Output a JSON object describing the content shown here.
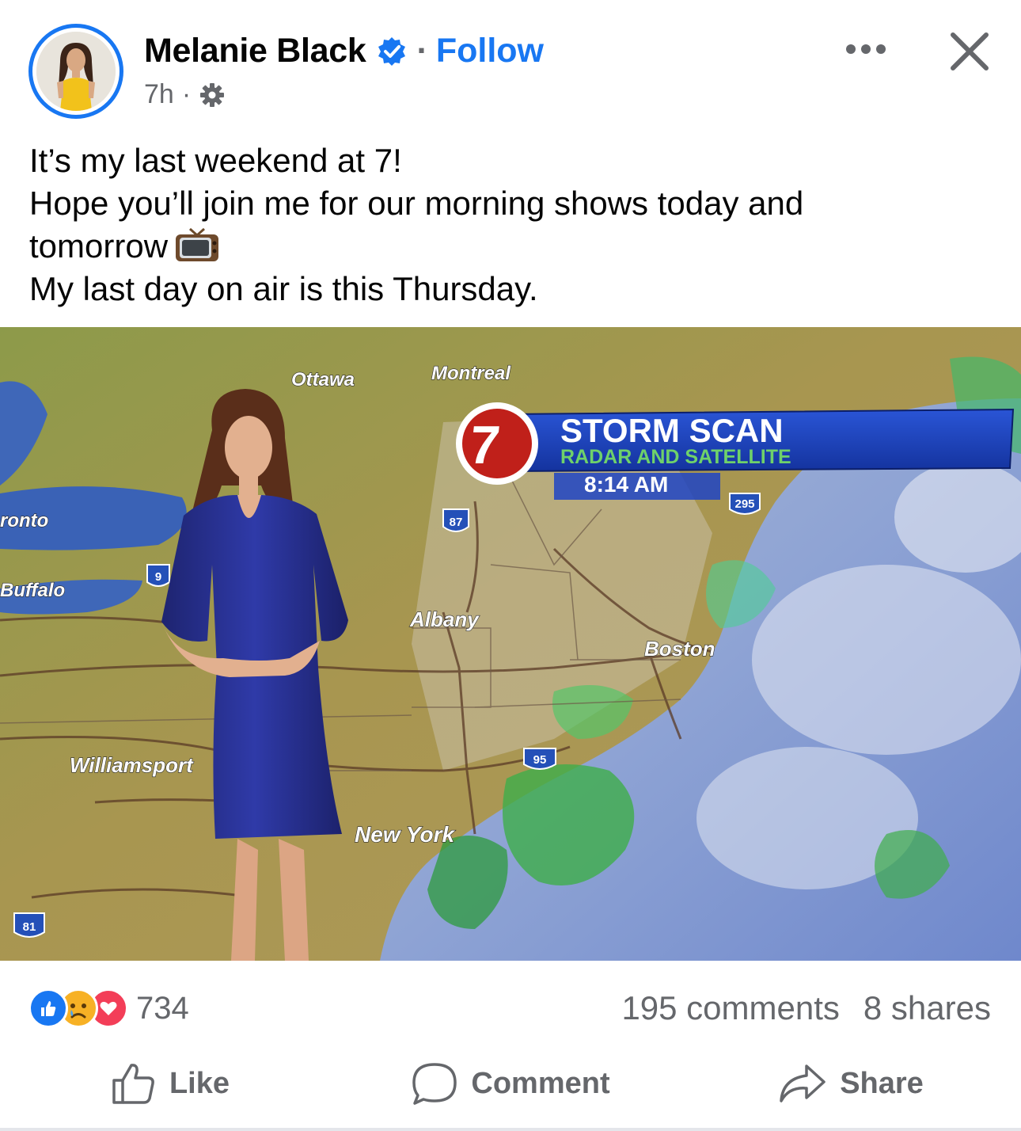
{
  "post": {
    "author": "Melanie Black",
    "verified_icon": "verified-badge-icon",
    "separator": "·",
    "follow_label": "Follow",
    "time": "7h",
    "meta_separator": "·",
    "audience_icon": "gear-icon",
    "more_icon": "more-options-icon",
    "close_icon": "close-icon",
    "text_lines": [
      "It’s my last weekend at 7!",
      "Hope you’ll join me for our morning shows today and",
      "tomorrow",
      "My last day on air is this Thursday."
    ],
    "emoji": "television-emoji"
  },
  "media": {
    "station_logo": "7",
    "banner_title": "STORM SCAN",
    "banner_subtitle": "RADAR AND SATELLITE",
    "banner_time": "8:14 AM",
    "city_labels": {
      "ottawa": "Ottawa",
      "montreal": "Montreal",
      "toronto": "ronto",
      "buffalo": "Buffalo",
      "albany": "Albany",
      "boston": "Boston",
      "williamsport": "Williamsport",
      "new_york": "New York"
    },
    "highway_shields": {
      "i87": "87",
      "i295": "295",
      "i9": "9",
      "i95": "95",
      "i81": "81"
    }
  },
  "engagement": {
    "reaction_icons": [
      "like-reaction-icon",
      "sad-reaction-icon",
      "love-reaction-icon"
    ],
    "reaction_count": "734",
    "comments": "195 comments",
    "shares": "8 shares"
  },
  "actions": {
    "like": "Like",
    "comment": "Comment",
    "share": "Share"
  },
  "colors": {
    "accent": "#1877f2",
    "secondary_text": "#65676b",
    "banner_blue": "#1a3fbf",
    "station_red": "#c0201a"
  }
}
